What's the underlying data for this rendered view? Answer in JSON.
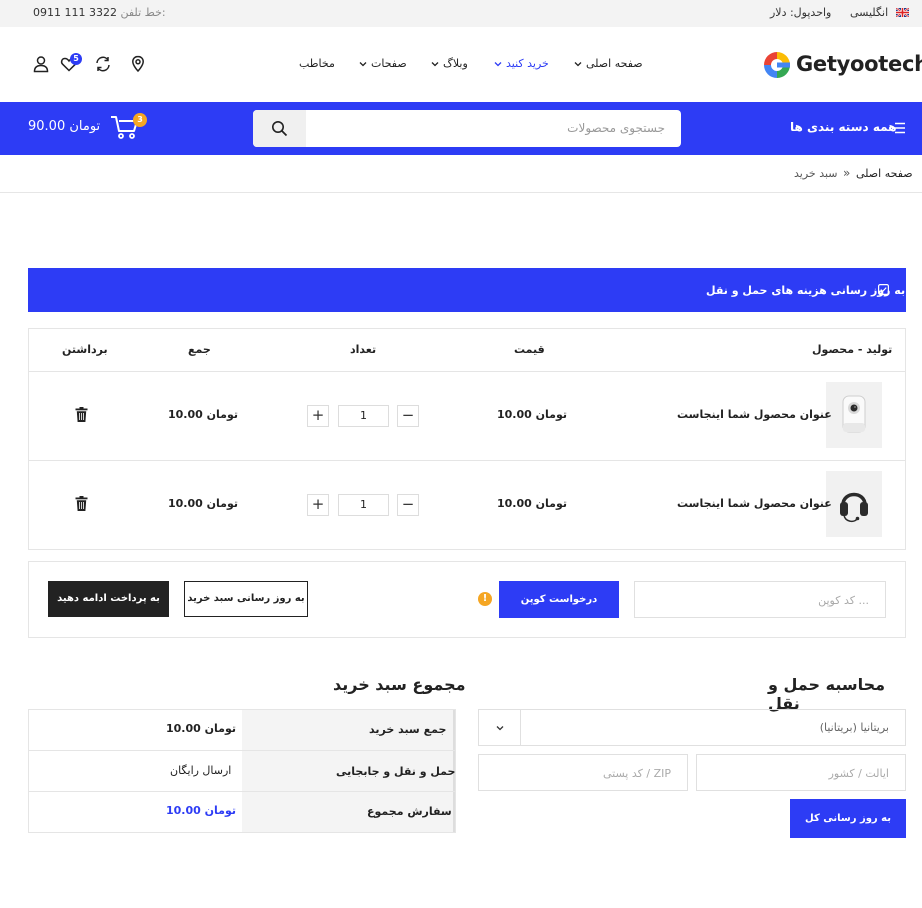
{
  "topbar": {
    "phone_label": "خط تلفن:",
    "phone_number": "0911 111 3322",
    "currency": "واحدپول: دلار",
    "language": "انگلیسی"
  },
  "header": {
    "logo_text": "Getyootech",
    "nav": [
      {
        "label": "صفحه اصلی"
      },
      {
        "label": "خرید کنید"
      },
      {
        "label": "وبلاگ"
      },
      {
        "label": "صفحات"
      },
      {
        "label": "مخاطب"
      }
    ],
    "wishlist_count": "5"
  },
  "bluebar": {
    "all_categories": "همه دسته بندی ها",
    "search_placeholder": "جستجوی محصولات",
    "cart_count": "3",
    "cart_total": "90.00 تومان"
  },
  "breadcrumb": {
    "home": "صفحه اصلی",
    "separator": "»",
    "current": "سبد خرید"
  },
  "notice": "به روز رسانی هزینه های حمل و نقل",
  "cart": {
    "headers": {
      "product": "تولید - محصول",
      "price": "قیمت",
      "quantity": "تعداد",
      "total": "جمع",
      "remove": "برداشتن"
    },
    "items": [
      {
        "name": "عنوان محصول شما اینجاست",
        "price": "10.00 تومان",
        "qty": "1",
        "total": "10.00 تومان",
        "image": "camera-image"
      },
      {
        "name": "عنوان محصول شما اینجاست",
        "price": "10.00 تومان",
        "qty": "1",
        "total": "10.00 تومان",
        "image": "headset-image"
      }
    ],
    "minus": "−",
    "plus": "+"
  },
  "actions": {
    "coupon_placeholder": "کد کوپن ...",
    "apply_coupon": "درخواست کوپن",
    "info": "!",
    "update_cart": "به روز رسانی سبد خرید",
    "checkout": "به پرداخت ادامه دهید"
  },
  "shipping": {
    "title": "محاسبه حمل و نقل",
    "country": "بریتانیا (بریتانیا)",
    "state_placeholder": "ایالت / کشور",
    "zip_placeholder": "کد پستی / ZIP",
    "update_button": "به روز رسانی کل"
  },
  "totals": {
    "title": "مجموع سبد خرید",
    "rows": [
      {
        "label": "جمع سبد خرید",
        "value": "10.00 تومان"
      },
      {
        "label": "حمل و نقل و جابجایی",
        "value": "ارسال رایگان"
      },
      {
        "label": "سفارش مجموع",
        "value": "10.00 تومان"
      }
    ]
  },
  "colors": {
    "primary": "#2d3cf5",
    "accent": "#f5a623",
    "dark": "#222222"
  }
}
